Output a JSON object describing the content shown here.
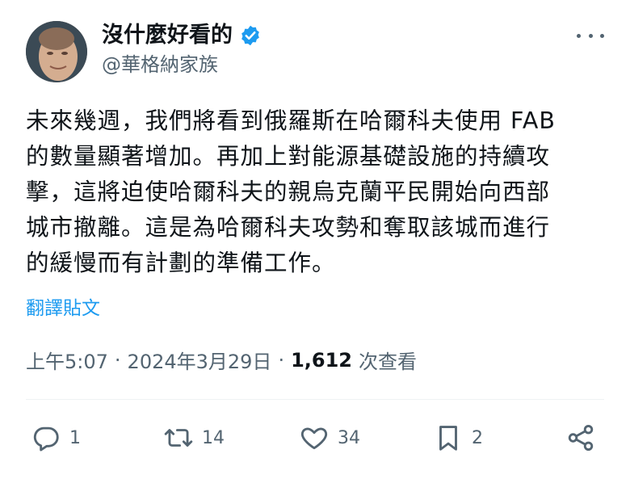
{
  "author": {
    "display_name": "沒什麼好看的",
    "handle": "@華格納家族",
    "verified": true
  },
  "tweet": {
    "lines": [
      "未來幾週，我們將看到俄羅斯在哈爾科夫使用 FAB",
      "的數量顯著增加。再加上對能源基礎設施的持續攻",
      "擊，這將迫使哈爾科夫的親烏克蘭平民開始向西部",
      "城市撤離。這是為哈爾科夫攻勢和奪取該城而進行",
      "的緩慢而有計劃的準備工作。"
    ],
    "translate_label": "翻譯貼文"
  },
  "meta": {
    "time": "上午5:07",
    "date": "2024年3月29日",
    "views_count": "1,612",
    "views_label": "次查看"
  },
  "actions": {
    "replies": "1",
    "retweets": "14",
    "likes": "34",
    "bookmarks": "2"
  },
  "colors": {
    "accent": "#1d9bf0",
    "secondary_text": "#536471",
    "primary_text": "#0f1419"
  }
}
